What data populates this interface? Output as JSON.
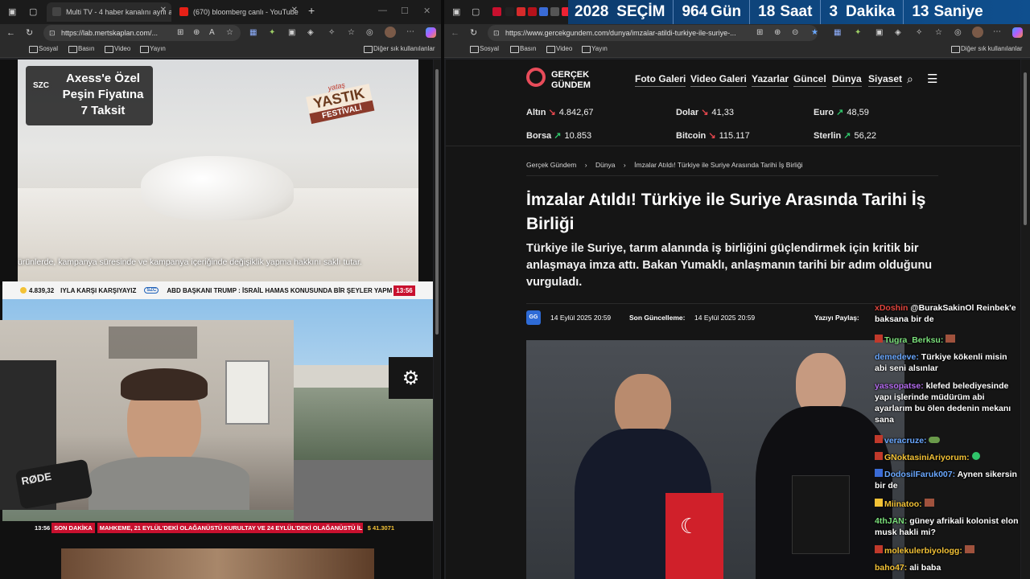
{
  "left_browser": {
    "tabs": [
      {
        "title": "Multi TV - 4 haber kanalını aynı a",
        "active": true
      },
      {
        "title": "(670) bloomberg canlı - YouTube",
        "active": false
      }
    ],
    "url": "https://lab.mertskaplan.com/...",
    "bookmarks": [
      "Sosyal",
      "Basın",
      "Video",
      "Yayın"
    ],
    "other_bookmarks": "Diğer sık kullanılanlar"
  },
  "video": {
    "promo_badge": "SZC",
    "promo_text": "Axess'e Özel Peşin Fiyatına 7 Taksit",
    "festival_logo_top": "yataş",
    "festival_logo_mid": "YASTIK",
    "festival_logo_bottom": "FESTİVALİ",
    "disclaimer": "ürünlerde, kampanya süresinde ve kampanya içeriğinde değişiklik yapma hakkını saklı tutar.",
    "ticker1_price": "4.839,32",
    "ticker1_text1": "IYLA KARŞI KARŞIYAYIZ",
    "ticker1_badge": "SZC",
    "ticker1_text2": "ABD BAŞKANI TRUMP : İSRAİL HAMAS KONUSUNDA BİR ŞEYLER YAPM",
    "ticker1_time": "13:56",
    "mic_brand": "RØDE",
    "ticker2_time": "13:56",
    "ticker2_label": "SON DAKİKA",
    "ticker2_text": "MAHKEME, 21 EYLÜL'DEKİ OLAĞANÜSTÜ KURULTAY VE 24 EYLÜL'DEKİ OLAĞANÜSTÜ İL",
    "ticker2_price": "$ 41.3071"
  },
  "countdown": {
    "year": "2028",
    "label": "SEÇİM",
    "days": "964",
    "days_label": "Gün",
    "hours": "18",
    "hours_label": "Saat",
    "minutes": "3",
    "minutes_label": "Dakika",
    "seconds": "13",
    "seconds_label": "Saniye"
  },
  "right_browser": {
    "url": "https://www.gercekgundem.com/dunya/imzalar-atildi-turkiye-ile-suriye-...",
    "bookmarks": [
      "Sosyal",
      "Basın",
      "Video",
      "Yayın"
    ],
    "other_bookmarks": "Diğer sık kullanılanlar"
  },
  "site": {
    "logo_line1": "GERÇEK",
    "logo_line2": "GÜNDEM",
    "nav": [
      "Foto Galeri",
      "Video Galeri",
      "Yazarlar",
      "Güncel",
      "Dünya",
      "Siyaset"
    ],
    "markets": [
      {
        "name": "Altın",
        "value": "4.842,67",
        "trend": "down"
      },
      {
        "name": "Dolar",
        "value": "41,33",
        "trend": "down"
      },
      {
        "name": "Euro",
        "value": "48,59",
        "trend": "up"
      },
      {
        "name": "Borsa",
        "value": "10.853",
        "trend": "up"
      },
      {
        "name": "Bitcoin",
        "value": "115.117",
        "trend": "down"
      },
      {
        "name": "Sterlin",
        "value": "56,22",
        "trend": "up"
      }
    ],
    "breadcrumb": [
      "Gerçek Gündem",
      "Dünya",
      "İmzalar Atıldı! Türkiye ile Suriye Arasında Tarihi İş Birliği"
    ],
    "headline": "İmzalar Atıldı! Türkiye ile Suriye Arasında Tarihi İş Birliği",
    "summary": "Türkiye ile Suriye, tarım alanında iş birliğini güçlendirmek için kritik bir anlaşmaya imza attı. Bakan Yumaklı, anlaşmanın tarihi bir adım olduğunu vurguladı.",
    "author_badge": "GG",
    "published": "14 Eylül 2025 20:59",
    "updated_label": "Son Güncelleme:",
    "updated": "14 Eylül 2025 20:59",
    "share_label": "Yazıyı Paylaş:"
  },
  "chat": [
    {
      "user": "xDoshin",
      "msg": "@BurakSakinOl Reinbek'e baksana bir de",
      "color": "#e0453d"
    },
    {
      "user": "Tugra_Berksu:",
      "msg": "",
      "color": "#7be07b"
    },
    {
      "user": "demedeve:",
      "msg": "Türkiye kökenli misin abi seni alsınlar",
      "color": "#6aa8ff"
    },
    {
      "user": "yassopatse:",
      "msg": "klefed belediyesinde yapı işlerinde müdürüm abi ayarlarım bu ölen dedenin mekanı sana",
      "color": "#b56cf0"
    },
    {
      "user": "veracruze:",
      "msg": "",
      "color": "#6aa8ff"
    },
    {
      "user": "GNoktasiniAriyorum:",
      "msg": "",
      "color": "#f3c236"
    },
    {
      "user": "DodosilFaruk007:",
      "msg": "Aynen sikersin bir de",
      "color": "#6aa8ff"
    },
    {
      "user": "Miinatoo:",
      "msg": "",
      "color": "#f3c236"
    },
    {
      "user": "4thJAN:",
      "msg": "güney afrikali kolonist elon musk hakli mi?",
      "color": "#7be07b"
    },
    {
      "user": "molekulerbiyologg:",
      "msg": "",
      "color": "#f3c236"
    },
    {
      "user": "baho47:",
      "msg": "ali baba",
      "color": "#f3c236"
    }
  ]
}
